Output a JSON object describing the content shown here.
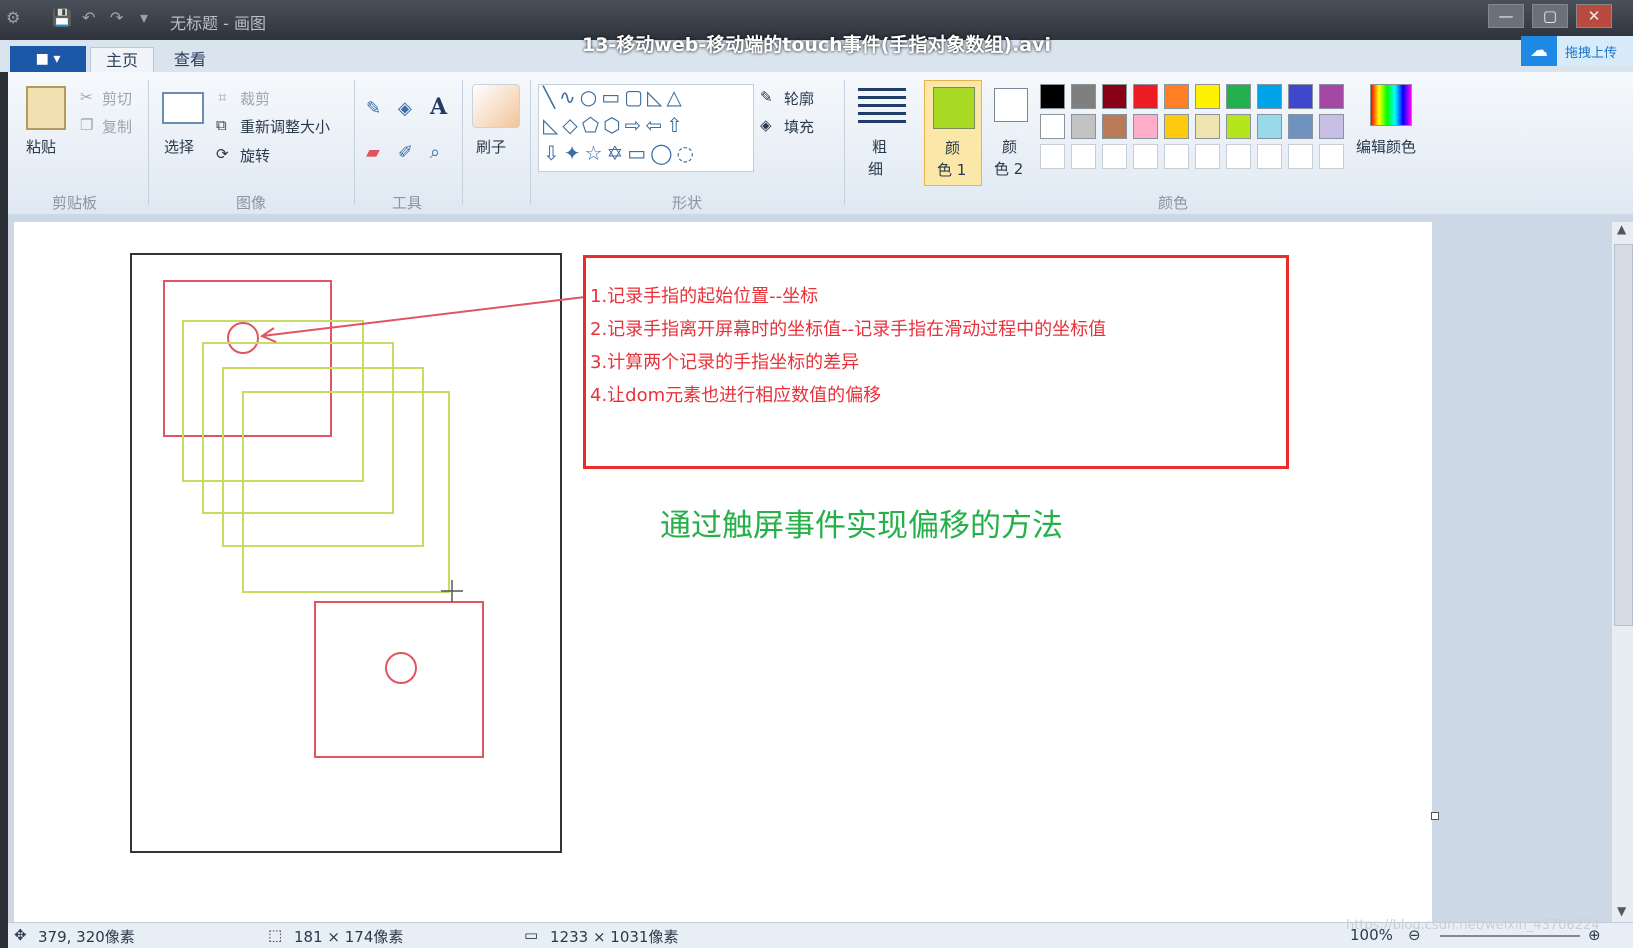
{
  "video_title": "13-移动web-移动端的touch事件(手指对象数组).avi",
  "window_title": "无标题 - 画图",
  "cloud_label": "拖拽上传",
  "tabs": {
    "file_icon": "■ ▾",
    "home": "主页",
    "view": "查看"
  },
  "clipboard": {
    "paste": "粘贴",
    "cut": "剪切",
    "copy": "复制",
    "group": "剪贴板"
  },
  "image": {
    "select": "选择",
    "crop": "裁剪",
    "resize": "重新调整大小",
    "rotate": "旋转",
    "group": "图像"
  },
  "tools": {
    "group": "工具"
  },
  "brush": {
    "label": "刷子"
  },
  "shapes": {
    "outline": "轮廓",
    "fill": "填充",
    "group": "形状"
  },
  "size": {
    "label_1": "粗",
    "label_2": "细"
  },
  "color1": {
    "line1": "颜",
    "line2": "色 1"
  },
  "color2": {
    "line1": "颜",
    "line2": "色 2"
  },
  "colors": {
    "group": "颜色",
    "edit": "编辑颜色",
    "row1": [
      "#000000",
      "#7f7f7f",
      "#880015",
      "#ed1c24",
      "#ff7f27",
      "#fff200",
      "#22b14c",
      "#00a2e8",
      "#3f48cc",
      "#a349a4"
    ],
    "row2": [
      "#ffffff",
      "#c3c3c3",
      "#b97a57",
      "#ffaec9",
      "#ffc90e",
      "#efe4b0",
      "#b5e61d",
      "#99d9ea",
      "#7092be",
      "#c8bfe7"
    ],
    "color1_value": "#a8d925"
  },
  "notes": {
    "line1": "1.记录手指的起始位置--坐标",
    "line2": "2.记录手指离开屏幕时的坐标值--记录手指在滑动过程中的坐标值",
    "line3": "3.计算两个记录的手指坐标的差异",
    "line4": "4.让dom元素也进行相应数值的偏移"
  },
  "heading": "通过触屏事件实现偏移的方法",
  "status": {
    "cursor_pos": "379, 320像素",
    "selection_size": "181 × 174像素",
    "canvas_size": "1233 × 1031像素",
    "zoom": "100%"
  },
  "watermark": "https://blog.csdn.net/weixin_43706224"
}
